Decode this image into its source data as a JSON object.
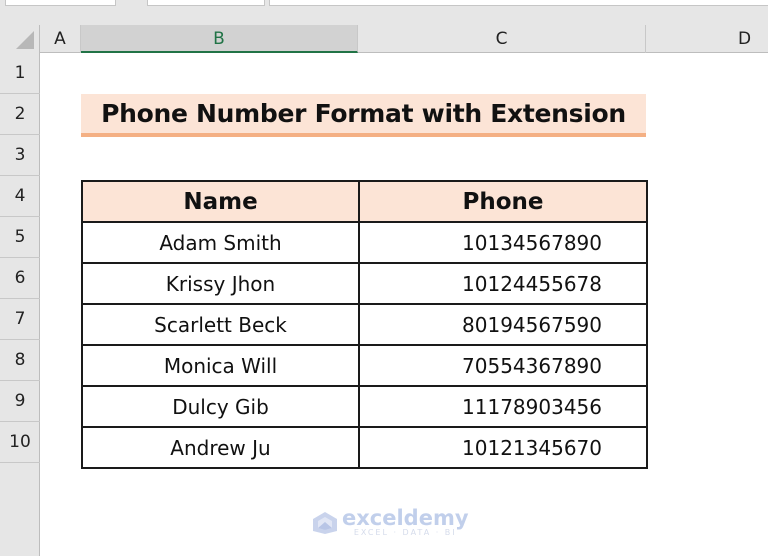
{
  "spreadsheet": {
    "columns": [
      "A",
      "B",
      "C",
      "D"
    ],
    "selected_column": "B",
    "rows": [
      "1",
      "2",
      "3",
      "4",
      "5",
      "6",
      "7",
      "8",
      "9",
      "10"
    ]
  },
  "title": "Phone Number Format with Extension",
  "table": {
    "headers": [
      "Name",
      "Phone"
    ],
    "rows": [
      {
        "name": "Adam Smith",
        "phone": "10134567890"
      },
      {
        "name": "Krissy Jhon",
        "phone": "10124455678"
      },
      {
        "name": "Scarlett Beck",
        "phone": "80194567590"
      },
      {
        "name": "Monica Will",
        "phone": "70554367890"
      },
      {
        "name": "Dulcy Gib",
        "phone": "11178903456"
      },
      {
        "name": "Andrew Ju",
        "phone": "10121345670"
      }
    ]
  },
  "watermark": {
    "name": "exceldemy",
    "tagline": "EXCEL · DATA · BI"
  },
  "colors": {
    "header_fill": "#fce4d6",
    "title_underline": "#f4b084",
    "selection_green": "#217346"
  }
}
